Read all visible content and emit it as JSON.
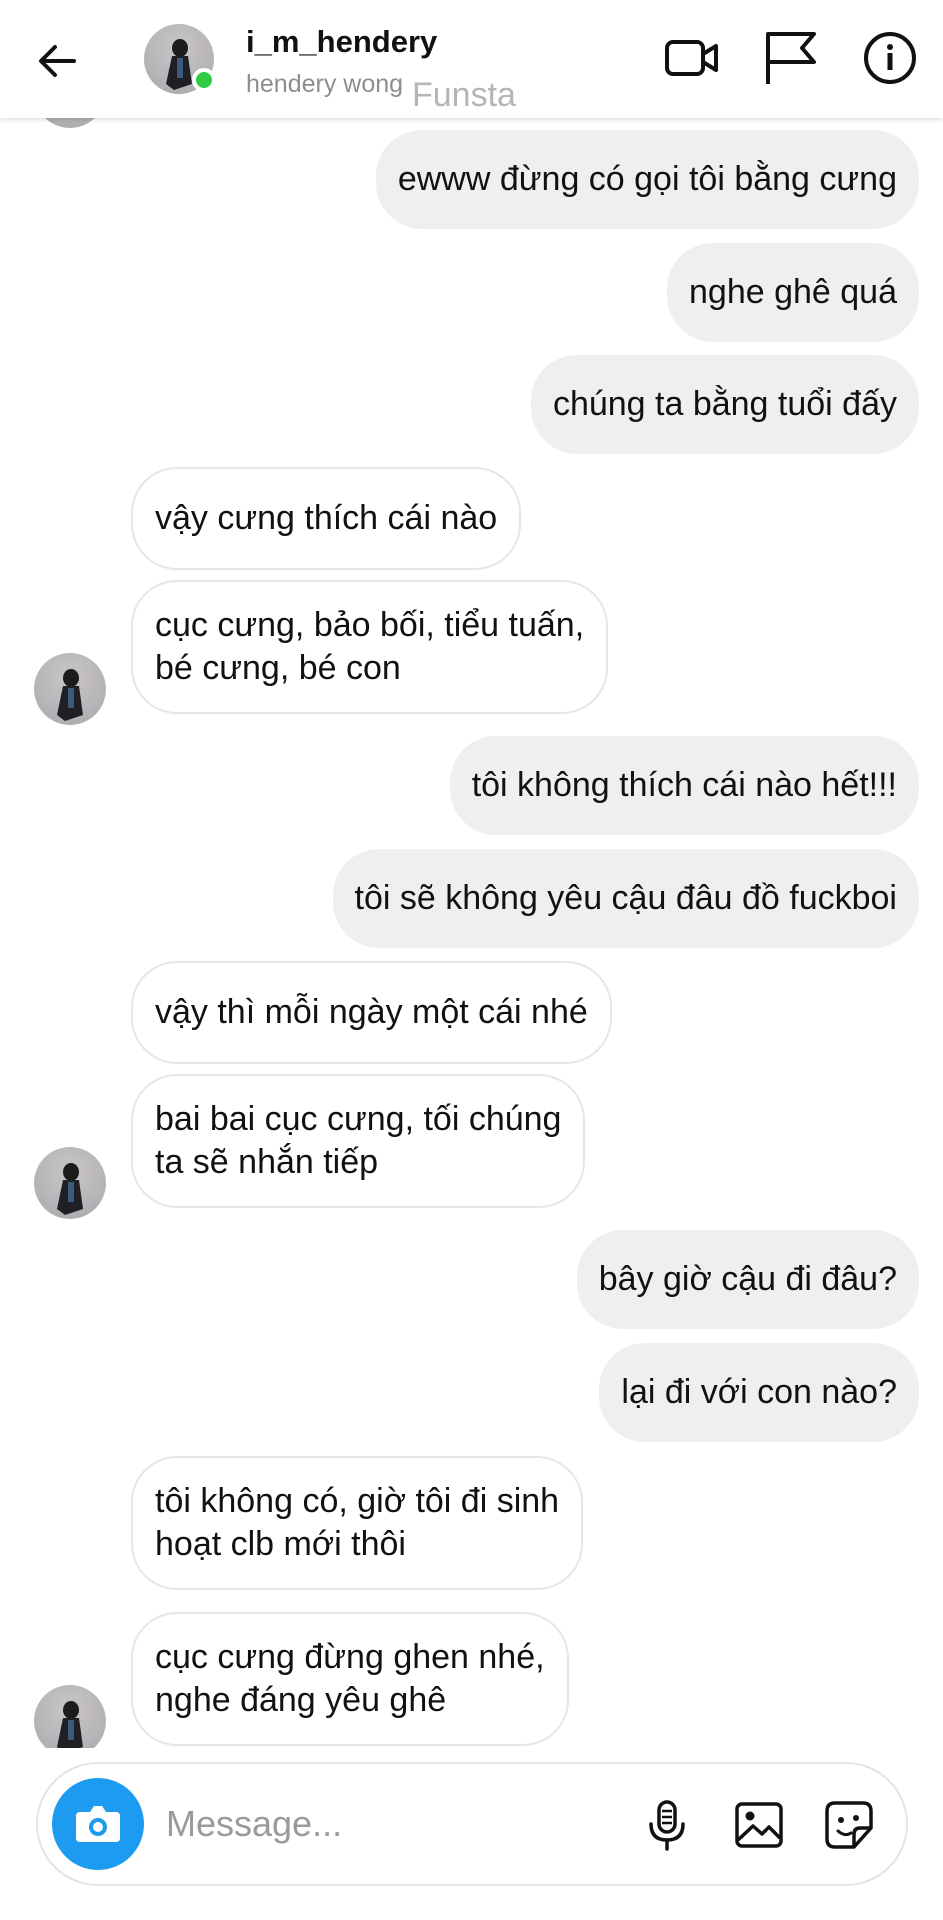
{
  "header": {
    "username": "i_m_hendery",
    "full_name": "hendery wong",
    "watermark": "Funsta",
    "icons": [
      "back-arrow-icon",
      "video-call-icon",
      "flag-icon",
      "info-icon"
    ]
  },
  "messages": [
    {
      "side": "out",
      "text": "ewww đừng có gọi tôi bằng cưng"
    },
    {
      "side": "out",
      "text": "nghe ghê quá"
    },
    {
      "side": "out",
      "text": "chúng ta bằng tuổi đấy"
    },
    {
      "side": "in",
      "text": "vậy cưng thích cái nào"
    },
    {
      "side": "in",
      "line1": "cục cưng, bảo bối, tiểu tuấn,",
      "line2": "bé cưng, bé con"
    },
    {
      "side": "out",
      "text": "tôi không thích cái nào hết!!!"
    },
    {
      "side": "out",
      "text": "tôi sẽ không yêu cậu đâu đồ fuckboi"
    },
    {
      "side": "in",
      "text": "vậy thì mỗi ngày một cái nhé"
    },
    {
      "side": "in",
      "line1": "bai bai cục cưng, tối chúng",
      "line2": "ta sẽ nhắn tiếp"
    },
    {
      "side": "out",
      "text": "bây giờ cậu đi đâu?"
    },
    {
      "side": "out",
      "text": "lại đi với con nào?"
    },
    {
      "side": "in",
      "line1": "tôi không có, giờ tôi đi sinh",
      "line2": "hoạt clb mới thôi"
    },
    {
      "side": "in",
      "line1": "cục cưng đừng ghen nhé,",
      "line2": "nghe đáng yêu ghê"
    }
  ],
  "composer": {
    "placeholder": "Message...",
    "icons": [
      "camera-icon",
      "microphone-icon",
      "gallery-icon",
      "sticker-icon"
    ]
  },
  "colors": {
    "outgoing_bubble": "#efefef",
    "incoming_border": "#e6e6e6",
    "camera_button": "#1d9bf0",
    "online_dot": "#2ecc40"
  }
}
